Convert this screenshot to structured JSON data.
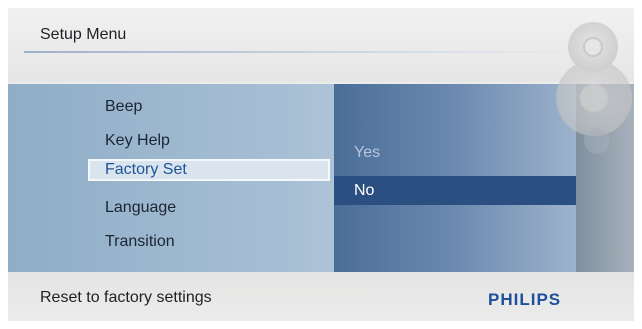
{
  "header": {
    "title": "Setup Menu"
  },
  "menu": {
    "items": [
      {
        "label": "Beep"
      },
      {
        "label": "Key Help"
      },
      {
        "label": "Factory Set"
      },
      {
        "label": "Language"
      },
      {
        "label": "Transition"
      }
    ],
    "selected": "Factory Set"
  },
  "submenu": {
    "options": [
      {
        "label": "Yes"
      },
      {
        "label": "No"
      }
    ],
    "selected": "No"
  },
  "footer": {
    "status": "Reset to factory settings",
    "brand": "PHILIPS"
  },
  "icons": {
    "control_top": "circle-button-icon",
    "control_mid": "dpad-icon",
    "control_low": "circle-button-icon"
  },
  "colors": {
    "selected_text": "#1e5596",
    "selected_option_bg": "#2b4f81",
    "brand": "#1d4f9c"
  }
}
